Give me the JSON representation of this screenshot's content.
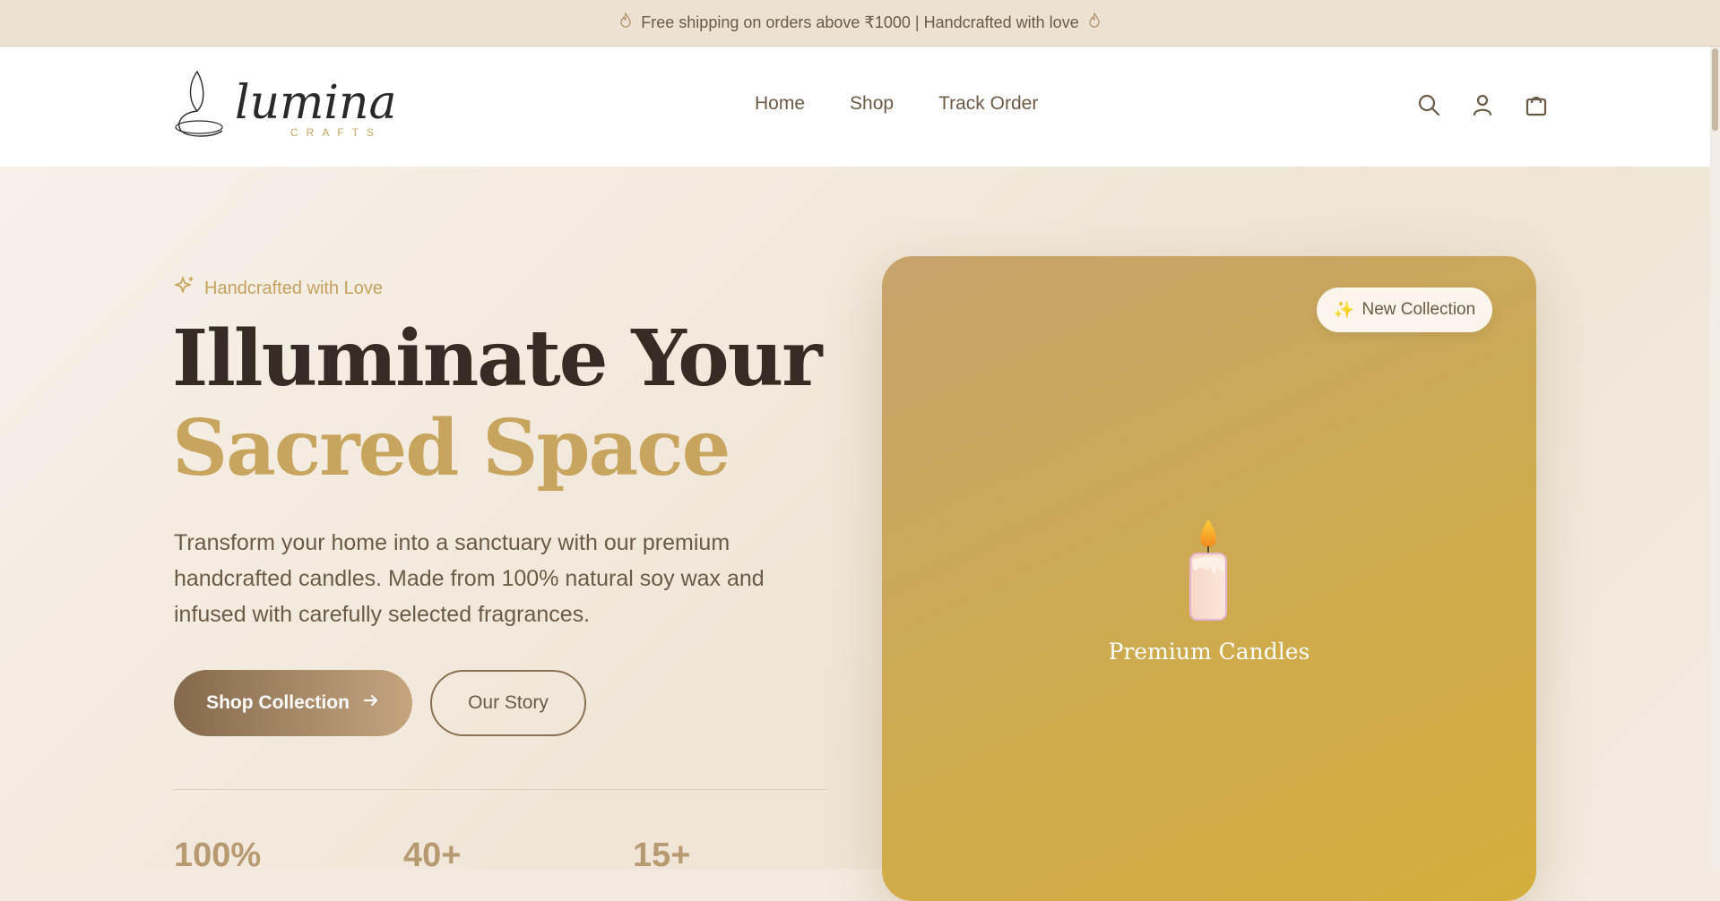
{
  "announcement": {
    "text": "Free shipping on orders above ₹1000 | Handcrafted with love",
    "icon": "flame-icon"
  },
  "header": {
    "logo": {
      "brand": "lumina",
      "sub": "CRAFTS"
    },
    "nav": [
      {
        "label": "Home"
      },
      {
        "label": "Shop"
      },
      {
        "label": "Track Order"
      }
    ],
    "icons": [
      "search-icon",
      "user-icon",
      "cart-icon"
    ]
  },
  "hero": {
    "tag": "Handcrafted with Love",
    "title_line1": "Illuminate Your",
    "title_line2": "Sacred Space",
    "description": "Transform your home into a sanctuary with our premium handcrafted candles. Made from 100% natural soy wax and infused with carefully selected fragrances.",
    "primary_button": "Shop Collection",
    "secondary_button": "Our Story",
    "stats": [
      {
        "value": "100%"
      },
      {
        "value": "40+"
      },
      {
        "value": "15+"
      }
    ]
  },
  "card": {
    "badge_icon": "✨",
    "badge": "New Collection",
    "label": "Premium Candles"
  },
  "colors": {
    "accent_gold": "#c7a55e",
    "text_dark": "#352c24",
    "text_brown": "#6b5a45",
    "background": "#f3ebe0"
  }
}
